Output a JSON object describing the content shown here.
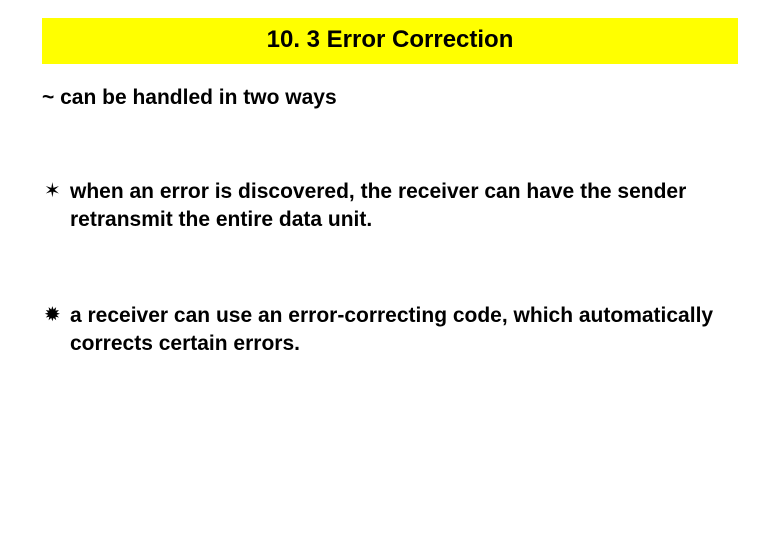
{
  "title": "10. 3 Error Correction",
  "subtitle": "~ can be handled in two ways",
  "items": [
    {
      "bullet": "✶",
      "text": "when an error is discovered, the receiver can have the sender retransmit the entire data unit."
    },
    {
      "bullet": "✹",
      "text": "a receiver can use an error-correcting code, which automatically corrects certain errors."
    }
  ]
}
